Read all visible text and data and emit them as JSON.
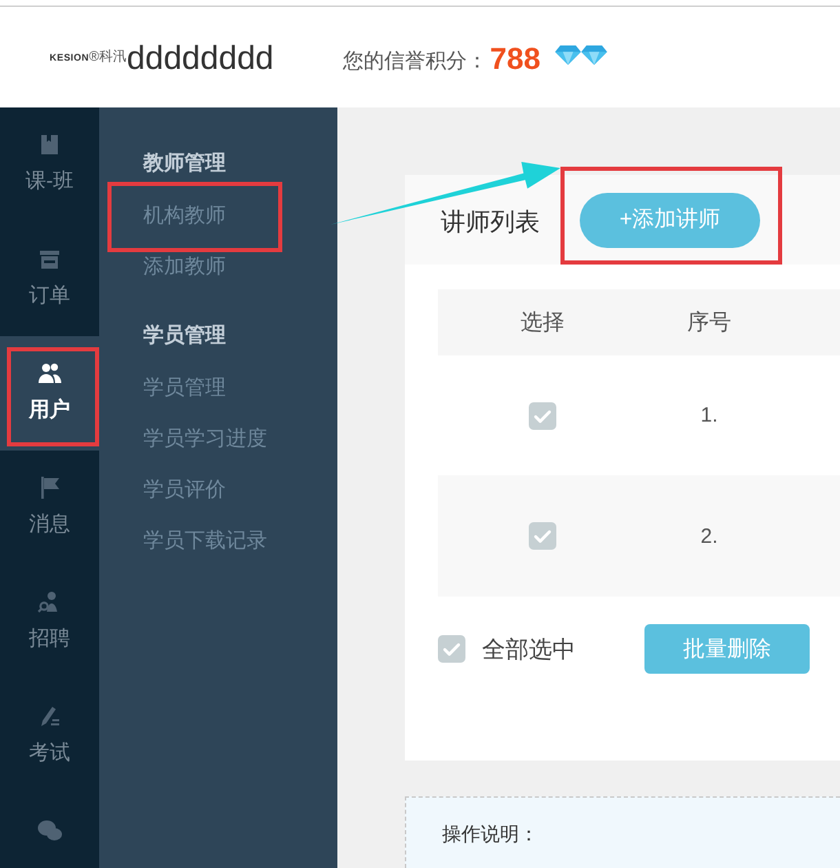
{
  "header": {
    "logo": {
      "wordmark": "KESION",
      "mark": "®科汛"
    },
    "username": "dddddddd",
    "credit_label": "您的信誉积分：",
    "credit_score": "788",
    "badges": [
      {
        "kind": "diamond"
      },
      {
        "kind": "diamond"
      }
    ]
  },
  "nav": [
    {
      "label": "课-班",
      "selected": false,
      "highlighted": false
    },
    {
      "label": "订单",
      "selected": false,
      "highlighted": false
    },
    {
      "label": "用户",
      "selected": true,
      "highlighted": true
    },
    {
      "label": "消息",
      "selected": false,
      "highlighted": false
    },
    {
      "label": "招聘",
      "selected": false,
      "highlighted": false
    },
    {
      "label": "考试",
      "selected": false,
      "highlighted": false
    },
    {
      "selected": false,
      "highlighted": false
    }
  ],
  "submenu": {
    "groups": [
      {
        "title": "教师管理",
        "items": [
          {
            "label": "机构教师",
            "highlighted": true
          },
          {
            "label": "添加教师",
            "highlighted": false
          }
        ]
      },
      {
        "title": "学员管理",
        "items": [
          {
            "label": "学员管理",
            "highlighted": false
          },
          {
            "label": "学员学习进度",
            "highlighted": false
          },
          {
            "label": "学员评价",
            "highlighted": false
          },
          {
            "label": "学员下载记录",
            "highlighted": false
          }
        ]
      }
    ]
  },
  "main": {
    "panel_title": "讲师列表",
    "add_button": {
      "label": "+添加讲师",
      "highlighted": true
    },
    "table": {
      "columns": [
        "选择",
        "序号"
      ],
      "rows": [
        {
          "checked": true,
          "number": "1."
        },
        {
          "checked": true,
          "number": "2."
        }
      ]
    },
    "select_all": {
      "label": "全部选中",
      "checked": true
    },
    "batch_delete_button": "批量删除",
    "notes": {
      "title": "操作说明："
    }
  }
}
